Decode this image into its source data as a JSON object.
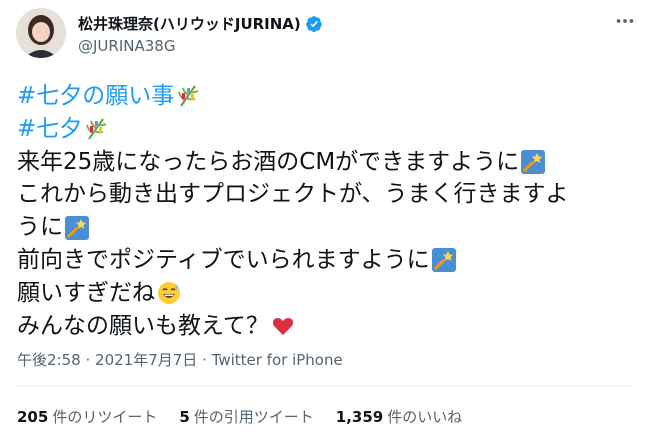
{
  "author": {
    "display_name": "松井珠理奈(ハリウッドJURINA)",
    "handle": "@JURINA38G",
    "verified": true,
    "avatar_icon": "profile-photo"
  },
  "tweet": {
    "lines": [
      {
        "text": "#七夕の願い事",
        "hashtag": true,
        "emoji": "tanabata-tree-icon"
      },
      {
        "text": "#七夕",
        "hashtag": true,
        "emoji": "tanabata-tree-icon"
      },
      {
        "text": "来年25歳になったらお酒のCMができますように",
        "hashtag": false,
        "emoji": "shooting-star-icon"
      },
      {
        "text": "これから動き出すプロジェクトが、うまく行きますよ",
        "hashtag": false,
        "emoji": ""
      },
      {
        "text": "うに",
        "hashtag": false,
        "emoji": "shooting-star-icon"
      },
      {
        "text": "前向きでポジティブでいられますように",
        "hashtag": false,
        "emoji": "shooting-star-icon"
      },
      {
        "text": "願いすぎだね",
        "hashtag": false,
        "emoji": "sweat-smile-icon"
      },
      {
        "text": "みんなの願いも教えて？",
        "hashtag": false,
        "emoji": "red-heart-icon"
      }
    ]
  },
  "meta": {
    "time": "午後2:58",
    "separator": "·",
    "date": "2021年7月7日",
    "source": "Twitter for iPhone"
  },
  "stats": {
    "retweets": {
      "count": "205",
      "label": "件のリツイート"
    },
    "quotes": {
      "count": "5",
      "label": "件の引用ツイート"
    },
    "likes": {
      "count": "1,359",
      "label": "件のいいね"
    }
  },
  "colors": {
    "text": "#0f1419",
    "secondary": "#536471",
    "link": "#1d9bf0",
    "divider": "#eff3f4"
  }
}
